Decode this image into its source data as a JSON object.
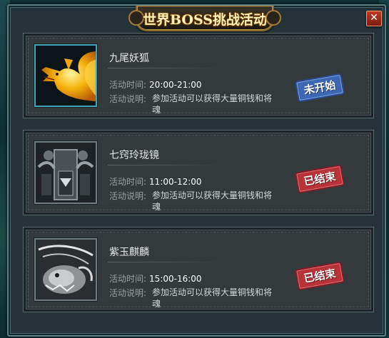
{
  "window": {
    "title": "世界BOSS挑战活动",
    "close_label": "✕"
  },
  "labels": {
    "time": "活动时间:",
    "desc": "活动说明:"
  },
  "bosses": [
    {
      "name": "九尾妖狐",
      "time": "20:00-21:00",
      "description": "参加活动可以获得大量铜钱和将魂",
      "status": "未开始",
      "status_color": "#3d67b3",
      "portrait_icon": "nine-tailed-fox-icon"
    },
    {
      "name": "七窍玲珑镜",
      "time": "11:00-12:00",
      "description": "参加活动可以获得大量铜钱和将魂",
      "status": "已结束",
      "status_color": "#b8323a",
      "portrait_icon": "mirror-icon"
    },
    {
      "name": "紫玉麒麟",
      "time": "15:00-16:00",
      "description": "参加活动可以获得大量铜钱和将魂",
      "status": "已结束",
      "status_color": "#b8323a",
      "portrait_icon": "qilin-icon"
    }
  ]
}
